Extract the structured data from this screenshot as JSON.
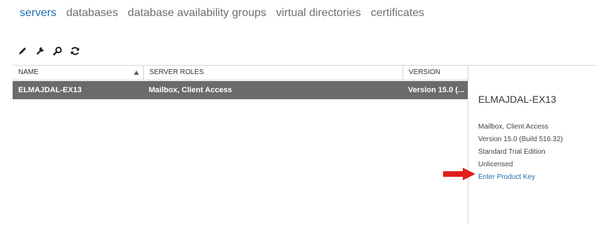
{
  "tabs": [
    {
      "label": "servers",
      "active": true
    },
    {
      "label": "databases",
      "active": false
    },
    {
      "label": "database availability groups",
      "active": false
    },
    {
      "label": "virtual directories",
      "active": false
    },
    {
      "label": "certificates",
      "active": false
    }
  ],
  "toolbar": {
    "icons": [
      "edit-pencil-icon",
      "wrench-icon",
      "search-icon",
      "refresh-icon"
    ]
  },
  "table": {
    "columns": [
      "NAME",
      "SERVER ROLES",
      "VERSION"
    ],
    "sort_indicator": "ascending",
    "rows": [
      {
        "name": "ELMAJDAL-EX13",
        "roles": "Mailbox, Client Access",
        "version": "Version 15.0 (...",
        "selected": true
      }
    ]
  },
  "details": {
    "title": "ELMAJDAL-EX13",
    "roles": "Mailbox, Client Access",
    "version": "Version 15.0 (Build 516.32)",
    "edition": "Standard Trial Edition",
    "license": "Unlicensed",
    "product_key_link": "Enter Product Key"
  },
  "colors": {
    "accent": "#1e6fb5",
    "selected_row": "#6b6b6b",
    "arrow": "#e0201a"
  }
}
